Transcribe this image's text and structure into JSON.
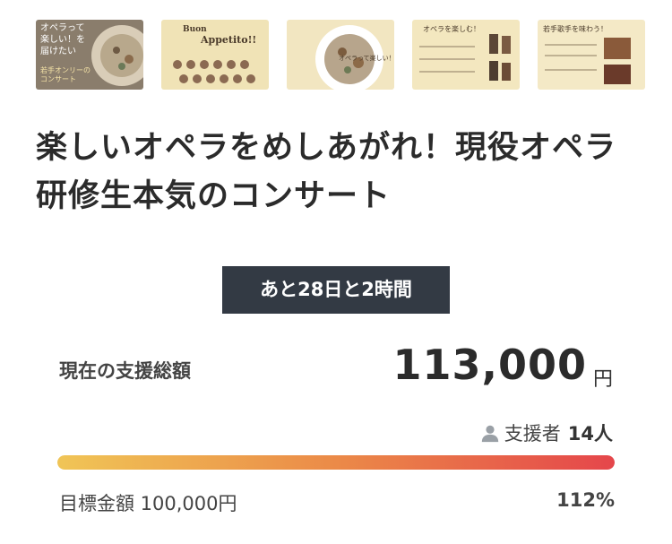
{
  "gallery": {
    "thumbnails": [
      {
        "name": "thumbnail-1",
        "lines": [
          "オペラって",
          "楽しい！を",
          "届けたい"
        ],
        "small": "若手オンリーの",
        "small2": "コンサート"
      },
      {
        "name": "thumbnail-2",
        "heading": "Buon",
        "heading2": "Appetito!!"
      },
      {
        "name": "thumbnail-3",
        "text": "オペラって楽しい！"
      },
      {
        "name": "thumbnail-4",
        "text": "オペラを楽しむ！"
      },
      {
        "name": "thumbnail-5",
        "text": "若手歌手を味わう！"
      }
    ]
  },
  "project": {
    "title": "楽しいオペラをめしあがれ！現役オペラ研修生本気のコンサート",
    "remaining": "あと28日と2時間"
  },
  "funding": {
    "total_label": "現在の支援総額",
    "total_amount": "113,000",
    "currency_unit": "円",
    "supporters_label": "支援者",
    "supporters_count": "14人",
    "goal_text": "目標金額 100,000円",
    "percent": "112%",
    "progress_fraction": 1.0
  },
  "colors": {
    "badge_bg": "#333a44",
    "progress_start": "#f0c556",
    "progress_end": "#e5464b"
  },
  "icons": {
    "supporters": "person-icon"
  }
}
